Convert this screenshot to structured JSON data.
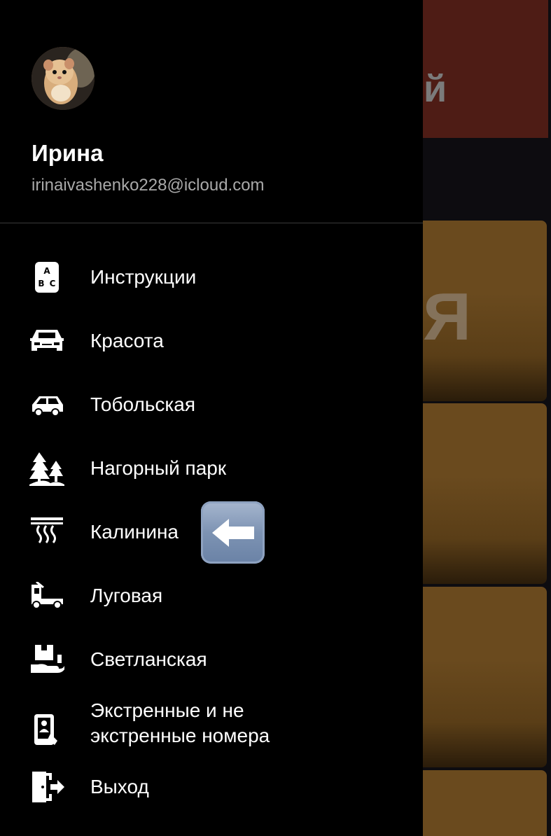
{
  "background": {
    "banner_letter": "й",
    "card_letter": "Я"
  },
  "profile": {
    "name": "Ирина",
    "email": "irinaivashenko228@icloud.com"
  },
  "menu": {
    "items": [
      {
        "label": "Инструкции",
        "icon": "abc-book-icon"
      },
      {
        "label": "Красота",
        "icon": "car-front-icon"
      },
      {
        "label": "Тобольская",
        "icon": "car-side-icon"
      },
      {
        "label": "Нагорный парк",
        "icon": "trees-icon"
      },
      {
        "label": "Калинина",
        "icon": "heater-icon"
      },
      {
        "label": "Луговая",
        "icon": "truck-icon"
      },
      {
        "label": "Светланская",
        "icon": "hand-package-icon"
      },
      {
        "label_line1": "Экстренные и не",
        "label_line2": "экстренные номера",
        "icon": "phone-contact-icon"
      },
      {
        "label": "Выход",
        "icon": "exit-door-icon"
      }
    ]
  },
  "annotation": {
    "icon": "left-arrow-emoji"
  }
}
